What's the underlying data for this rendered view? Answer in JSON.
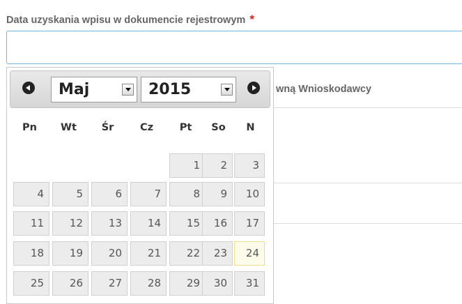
{
  "form": {
    "date_label": "Data uzyskania wpisu w dokumencie rejestrowym",
    "required_mark": "*",
    "date_value": ""
  },
  "background": {
    "partial_label": "wną Wnioskodawcy"
  },
  "datepicker": {
    "month": "Maj",
    "year": "2015",
    "weekdays": [
      "Pn",
      "Wt",
      "Śr",
      "Cz",
      "Pt",
      "So",
      "N"
    ],
    "weeks": [
      [
        "",
        "",
        "",
        "",
        "1",
        "2",
        "3"
      ],
      [
        "4",
        "5",
        "6",
        "7",
        "8",
        "9",
        "10"
      ],
      [
        "11",
        "12",
        "13",
        "14",
        "15",
        "16",
        "17"
      ],
      [
        "18",
        "19",
        "20",
        "21",
        "22",
        "23",
        "24"
      ],
      [
        "25",
        "26",
        "27",
        "28",
        "29",
        "30",
        "31"
      ]
    ],
    "highlighted_day": "24"
  }
}
